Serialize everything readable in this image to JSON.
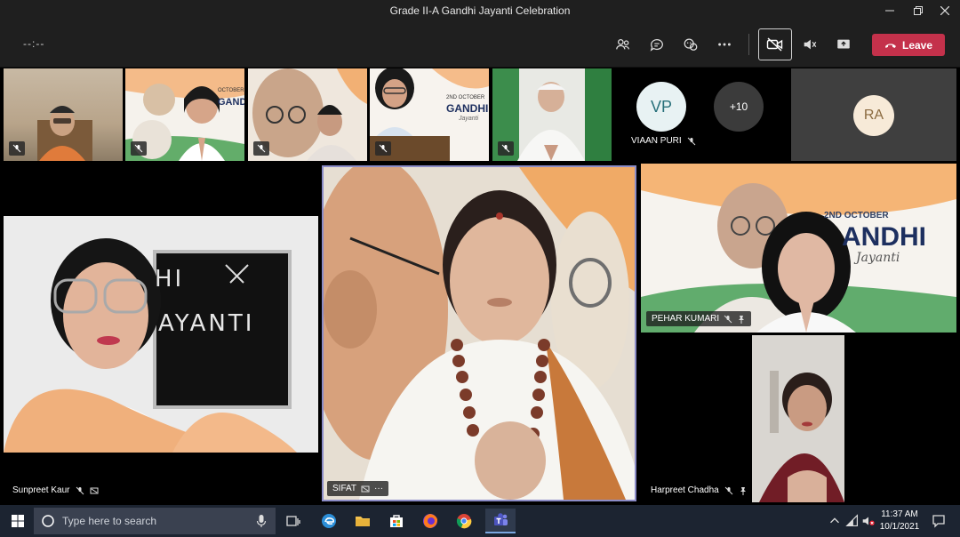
{
  "window": {
    "title": "Grade II-A Gandhi Jayanti Celebration"
  },
  "toolbar": {
    "timer": "--:--",
    "icons": [
      "people-icon",
      "chat-icon",
      "reactions-icon",
      "more-icon",
      "camera-off-icon",
      "mic-off-icon",
      "share-icon"
    ],
    "leave_label": "Leave",
    "leave_color": "#c4314b"
  },
  "participants": {
    "avatar_vp": {
      "initials": "VP",
      "name": "VIAAN PURI"
    },
    "overflow": {
      "label": "+10"
    },
    "avatar_ra": {
      "initials": "RA"
    },
    "sunpreet": {
      "name": "Sunpreet Kaur"
    },
    "sifat": {
      "name": "SIFAT",
      "more": "···"
    },
    "pehar": {
      "name": "PEHAR KUMARI"
    },
    "harpreet": {
      "name": "Harpreet Chadha"
    },
    "slide_texts": {
      "board": [
        "HI",
        "AYANTI"
      ],
      "poster_small": [
        "OCTOBER",
        "GANDHI",
        "Jayanti"
      ],
      "poster_right": [
        "2ND OCTOBER",
        "ANDHI",
        "Jayanti"
      ],
      "poster_tile2": [
        "OCTOBER",
        "GANDHI",
        "Jayanti"
      ],
      "poster_tile4": [
        "2ND OCTOBER",
        "GANDHI",
        "Jayanti"
      ]
    }
  },
  "taskbar": {
    "search_placeholder": "Type here to search",
    "time": "11:37 AM",
    "date": "10/1/2021"
  }
}
